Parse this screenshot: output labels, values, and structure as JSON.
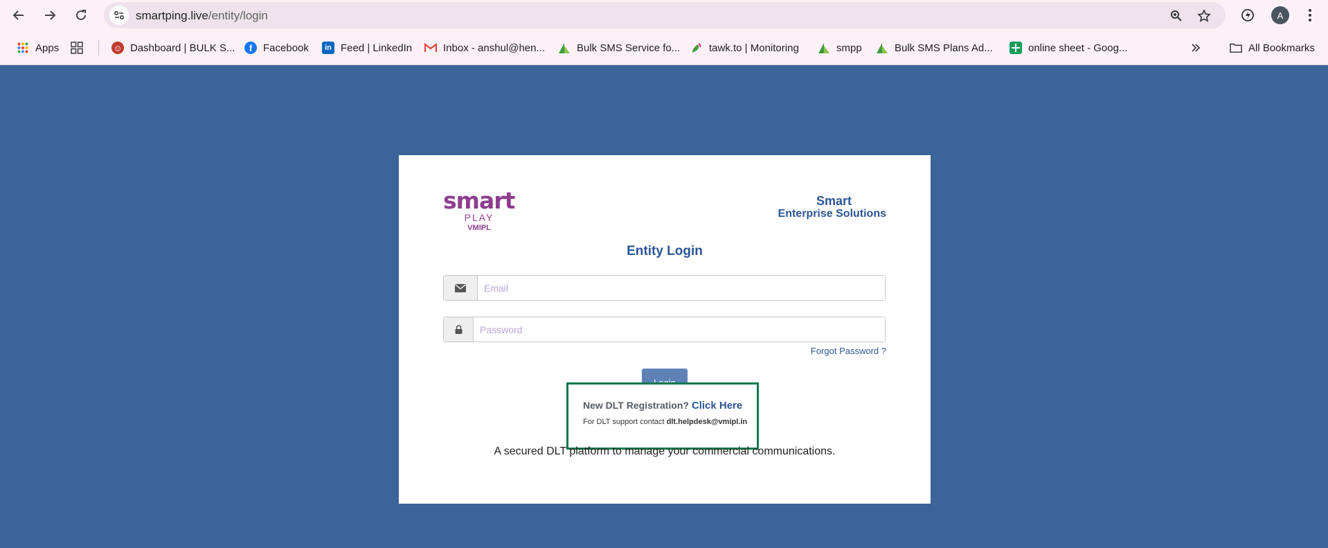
{
  "browser": {
    "url_host": "smartping.live",
    "url_path": "/entity/login",
    "avatar_letter": "A"
  },
  "bookmarks": {
    "items": [
      {
        "label": "Apps",
        "icon": "apps-grid-icon"
      },
      {
        "label": "",
        "icon": "tab-groups-icon"
      },
      {
        "label": "Dashboard | BULK S...",
        "icon": "ghost-icon"
      },
      {
        "label": "Facebook",
        "icon": "facebook-icon"
      },
      {
        "label": "Feed | LinkedIn",
        "icon": "linkedin-icon"
      },
      {
        "label": "Inbox - anshul@hen...",
        "icon": "gmail-icon"
      },
      {
        "label": "Bulk SMS Service fo...",
        "icon": "bulksms-icon"
      },
      {
        "label": "tawk.to | Monitoring",
        "icon": "tawk-icon"
      },
      {
        "label": "smpp",
        "icon": "bulksms-icon"
      },
      {
        "label": "Bulk SMS Plans Ad...",
        "icon": "bulksms-icon"
      },
      {
        "label": "online sheet - Goog...",
        "icon": "sheets-icon"
      }
    ],
    "all_bookmarks": "All Bookmarks"
  },
  "logo": {
    "smart": "smart",
    "play": "PLAY",
    "vmipl": "VMIPL"
  },
  "brand": {
    "line1": "Smart",
    "line2": "Enterprise Solutions"
  },
  "login": {
    "title": "Entity Login",
    "email_placeholder": "Email",
    "password_placeholder": "Password",
    "forgot": "Forgot Password ?",
    "button": "Login"
  },
  "registration": {
    "question": "New DLT Registration?",
    "link": "Click Here",
    "support_prefix": "For DLT support contact",
    "support_email": "dlt.helpdesk@vmipl.in"
  },
  "tagline": "A secured DLT platform to manage your commercial communications.",
  "colors": {
    "background": "#3b6499",
    "brand_purple": "#8e3e8f",
    "brand_blue": "#2c5596",
    "highlight_box": "#0d7a4e"
  }
}
